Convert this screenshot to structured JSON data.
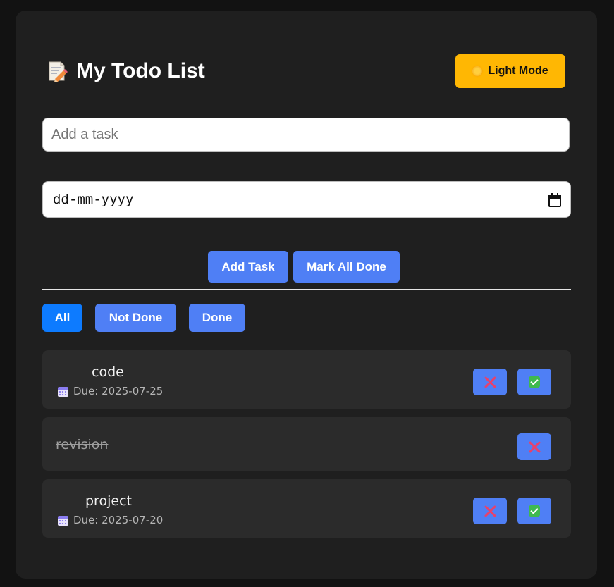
{
  "app": {
    "title": "My Todo List",
    "theme_button_label": "Light Mode",
    "accent_color": "#ffb703"
  },
  "form": {
    "task_placeholder": "Add a task",
    "date_placeholder": "dd-mm-yyyy",
    "add_label": "Add Task",
    "mark_all_label": "Mark All Done"
  },
  "filters": {
    "all": "All",
    "not_done": "Not Done",
    "done": "Done",
    "active": "All"
  },
  "tasks": [
    {
      "title": "code",
      "due": "Due: 2025-07-25",
      "done": false
    },
    {
      "title": "revision",
      "due": "",
      "done": true
    },
    {
      "title": "project",
      "due": "Due: 2025-07-20",
      "done": false
    }
  ],
  "icons": {
    "title_icon": "memo-pencil-icon",
    "theme_icon": "sun-icon",
    "calendar_icon": "calendar-icon",
    "delete_icon": "cross-mark-icon",
    "complete_icon": "check-box-icon"
  }
}
